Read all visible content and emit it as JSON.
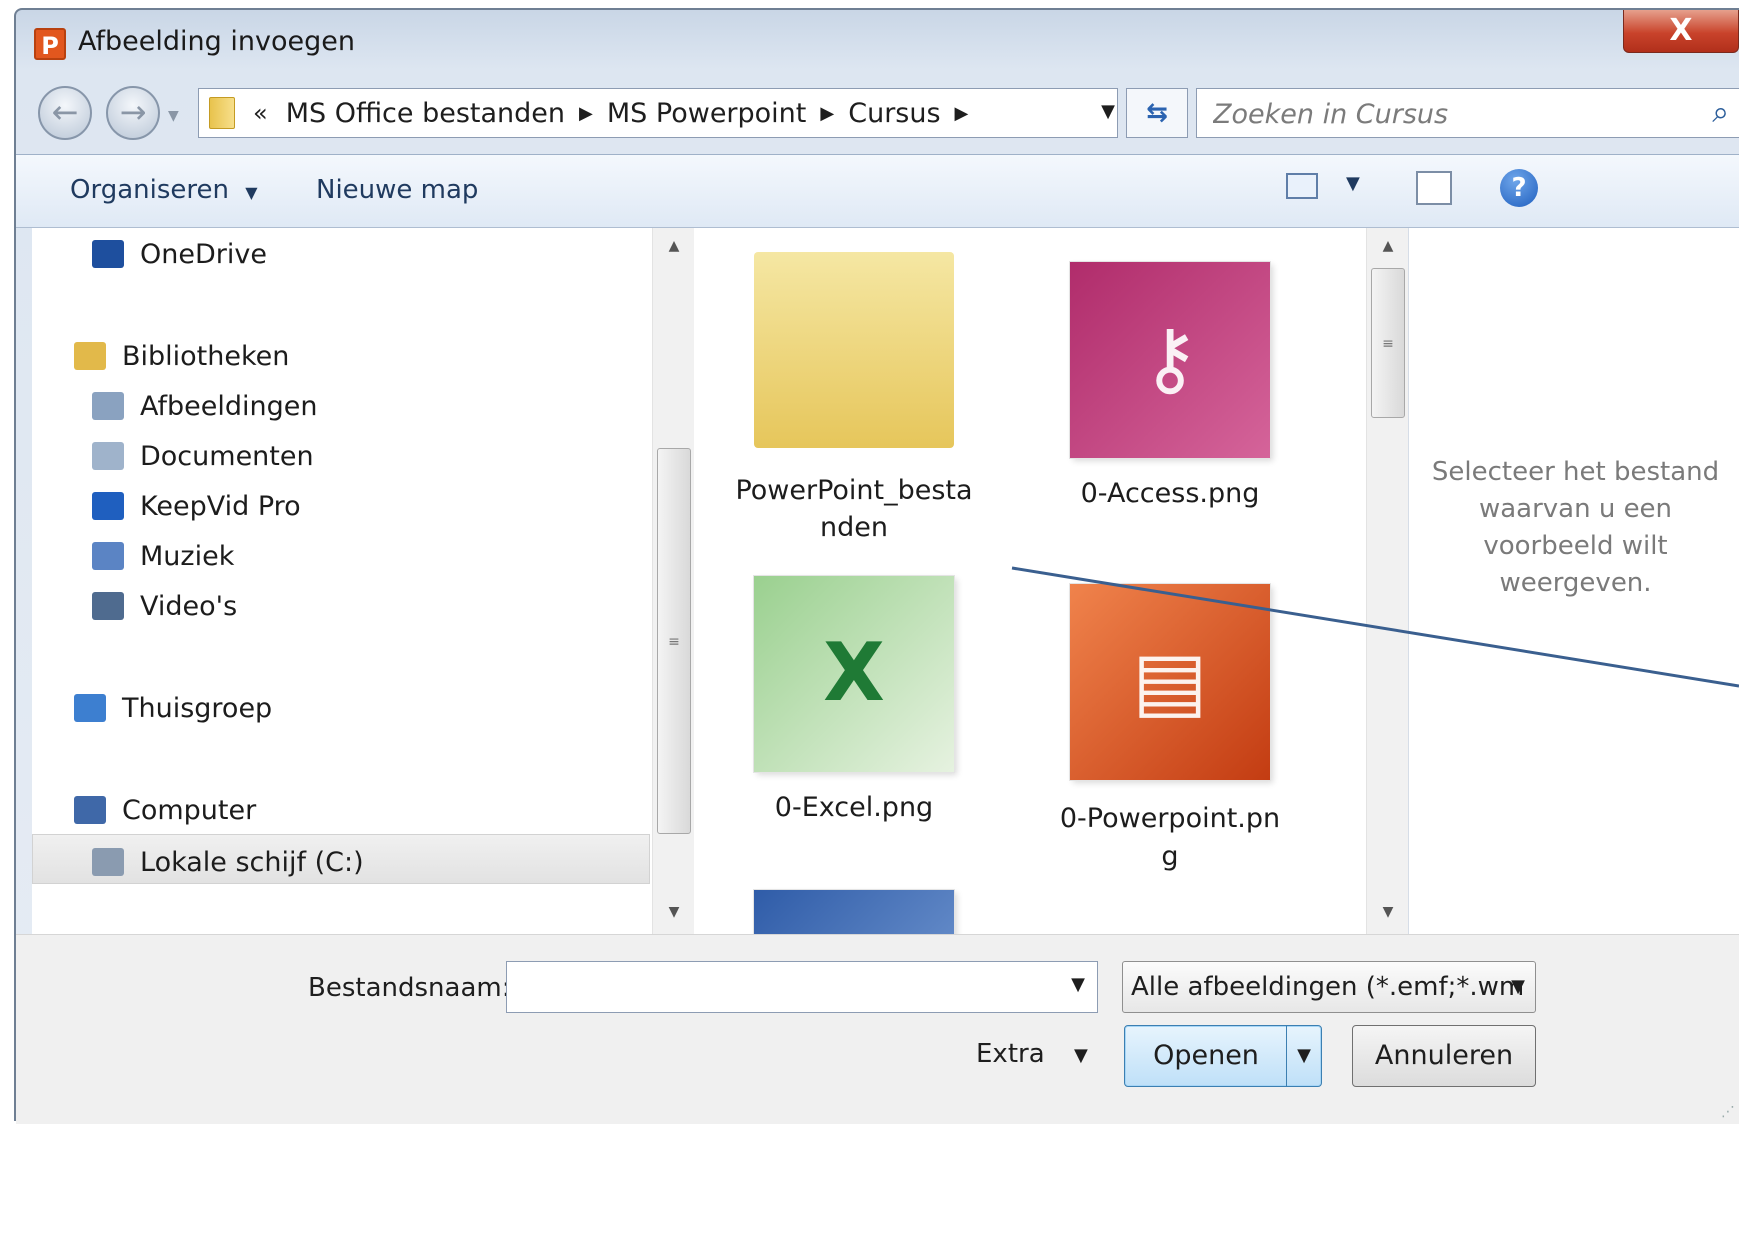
{
  "window": {
    "title": "Afbeelding invoegen",
    "app_icon_letter": "P",
    "close_label": "X"
  },
  "navigation": {
    "breadcrumbs_prefix": "«",
    "breadcrumbs": [
      "MS Office bestanden",
      "MS Powerpoint",
      "Cursus"
    ],
    "search_placeholder": "Zoeken in Cursus"
  },
  "toolbar": {
    "organize_label": "Organiseren",
    "new_folder_label": "Nieuwe map",
    "help_label": "?"
  },
  "sidebar": {
    "items": [
      {
        "label": "OneDrive",
        "icon": "cloud-icon",
        "color": "#1e4f9e"
      },
      {
        "label": "Bibliotheken",
        "icon": "libraries-icon",
        "color": "#e2b94a"
      },
      {
        "label": "Afbeeldingen",
        "icon": "pictures-library-icon",
        "color": "#8aa2c0"
      },
      {
        "label": "Documenten",
        "icon": "documents-library-icon",
        "color": "#9fb3cb"
      },
      {
        "label": "KeepVid Pro",
        "icon": "keepvid-icon",
        "color": "#1f5fbf"
      },
      {
        "label": "Muziek",
        "icon": "music-library-icon",
        "color": "#5b84c4"
      },
      {
        "label": "Video's",
        "icon": "videos-library-icon",
        "color": "#4f6b8f"
      },
      {
        "label": "Thuisgroep",
        "icon": "homegroup-icon",
        "color": "#3d7fd0"
      },
      {
        "label": "Computer",
        "icon": "computer-icon",
        "color": "#3f68a8"
      },
      {
        "label": "Lokale schijf (C:)",
        "icon": "local-disk-icon",
        "color": "#8a9bb0"
      }
    ]
  },
  "files": [
    {
      "name": "PowerPoint_besta\nnden",
      "type": "folder",
      "glyph": ""
    },
    {
      "name": "0-Access.png",
      "type": "access",
      "glyph": "⚷"
    },
    {
      "name": "0-Excel.png",
      "type": "excel",
      "glyph": "X"
    },
    {
      "name": "0-Powerpoint.pn\ng",
      "type": "ppt",
      "glyph": "▤"
    }
  ],
  "preview": {
    "message": "Selecteer het bestand waarvan u een voorbeeld wilt weergeven."
  },
  "footer": {
    "filename_label": "Bestandsnaam:",
    "filename_value": "",
    "filetype_value": "Alle afbeeldingen (*.emf;*.wm",
    "extra_label": "Extra",
    "open_label": "Openen",
    "cancel_label": "Annuleren"
  },
  "colors": {
    "annotation_line": "#3a5f8f",
    "close_button": "#c9432b"
  }
}
